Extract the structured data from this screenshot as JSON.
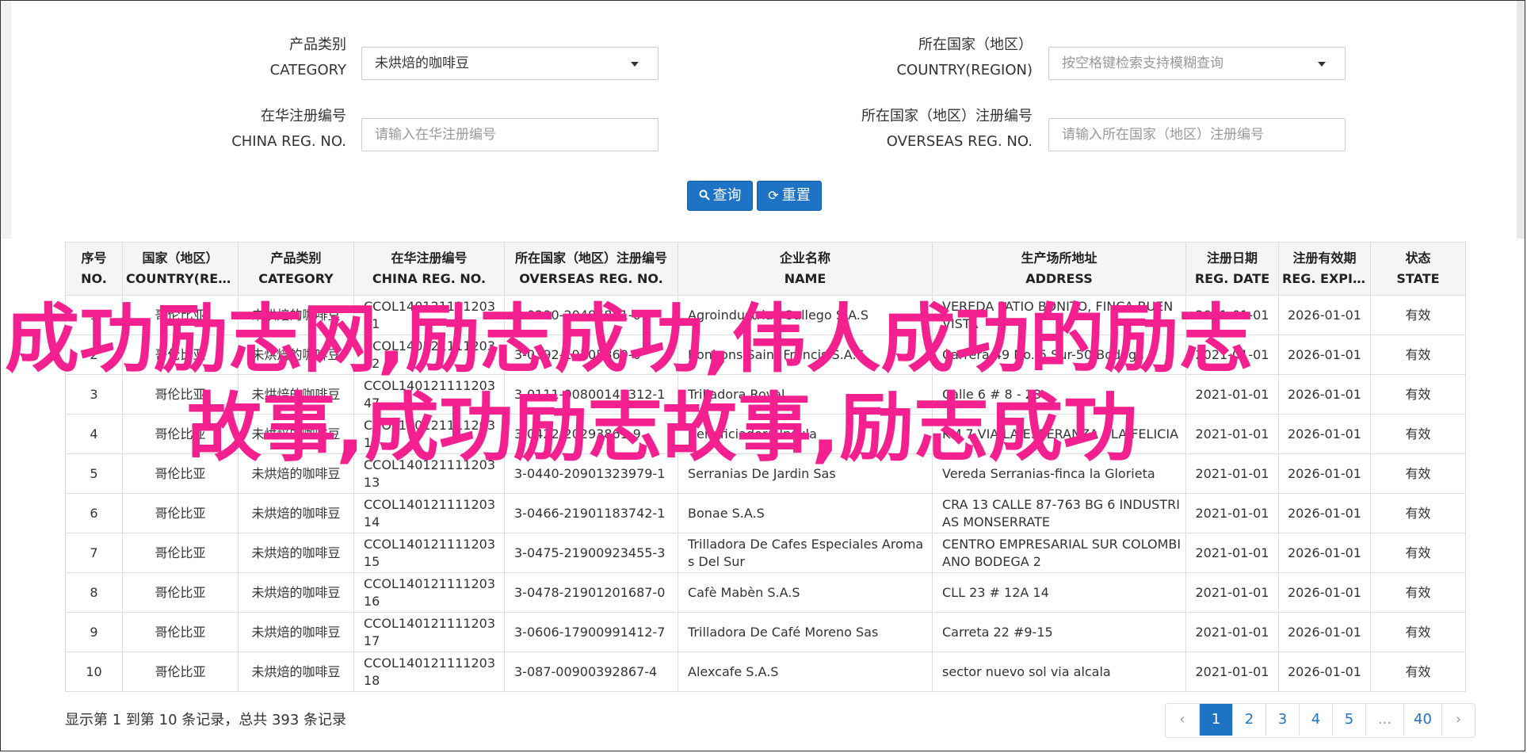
{
  "form": {
    "category_label_cn": "产品类别",
    "category_label_en": "CATEGORY",
    "category_value": "未烘焙的咖啡豆",
    "country_label_cn": "所在国家（地区）",
    "country_label_en": "COUNTRY(REGION)",
    "country_placeholder": "按空格键检索支持模糊查询",
    "china_reg_label_cn": "在华注册编号",
    "china_reg_label_en": "CHINA REG. NO.",
    "china_reg_placeholder": "请输入在华注册编号",
    "overseas_reg_label_cn": "所在国家（地区）注册编号",
    "overseas_reg_label_en": "OVERSEAS REG. NO.",
    "overseas_reg_placeholder": "请输入所在国家（地区）注册编号",
    "query_label": "查询",
    "reset_label": "重置"
  },
  "table": {
    "columns": [
      {
        "cn": "序号",
        "en": "NO."
      },
      {
        "cn": "国家（地区）",
        "en": "COUNTRY(REGIO..."
      },
      {
        "cn": "产品类别",
        "en": "CATEGORY"
      },
      {
        "cn": "在华注册编号",
        "en": "CHINA REG. NO."
      },
      {
        "cn": "所在国家（地区）注册编号",
        "en": "OVERSEAS REG. NO."
      },
      {
        "cn": "企业名称",
        "en": "NAME"
      },
      {
        "cn": "生产场所地址",
        "en": "ADDRESS"
      },
      {
        "cn": "注册日期",
        "en": "REG. DATE"
      },
      {
        "cn": "注册有效期",
        "en": "REG. EXPIRE ..."
      },
      {
        "cn": "状态",
        "en": "STATE"
      }
    ],
    "rows": [
      [
        "1",
        "哥伦比亚",
        "未烘焙的咖啡豆",
        "CCOL14012111120311",
        "3-0290-20486851-0",
        "Agroindustrias Gallego S.A.S",
        "VEREDA PATIO BONITO, FINCA BUEN VISTA",
        "2021-01-01",
        "2026-01-01",
        "有效"
      ],
      [
        "2",
        "哥伦比亚",
        "未烘焙的咖啡豆",
        "CCOL14012111120312",
        "3-0392-19305869-0",
        "Bonbons Saint Francis S.A.S",
        "Carrera 49 No. 5 Sur-50 Bodega 5",
        "2021-01-01",
        "2026-01-01",
        "有效"
      ],
      [
        "3",
        "哥伦比亚",
        "未烘焙的咖啡豆",
        "CCOL14012111120347",
        "3-0111-00800148312-1",
        "Trilladora Royal",
        "Calle 6 # 8 - 23",
        "2021-01-01",
        "2026-01-01",
        "有效"
      ],
      [
        "4",
        "哥伦比亚",
        "未烘焙的咖啡豆",
        "CCOL14012111120312",
        "3-0422-20293861-9",
        "Beneficiadora Insula",
        "KM 7 VIA LA ESPERANZA - LA FELICIA",
        "2021-01-01",
        "2026-01-01",
        "有效"
      ],
      [
        "5",
        "哥伦比亚",
        "未烘焙的咖啡豆",
        "CCOL14012111120313",
        "3-0440-20901323979-1",
        "Serranias De Jardin Sas",
        "Vereda Serranias-finca la Glorieta",
        "2021-01-01",
        "2026-01-01",
        "有效"
      ],
      [
        "6",
        "哥伦比亚",
        "未烘焙的咖啡豆",
        "CCOL14012111120314",
        "3-0466-21901183742-1",
        "Bonae S.A.S",
        "CRA 13 CALLE 87-763 BG 6 INDUSTRIAS MONSERRATE",
        "2021-01-01",
        "2026-01-01",
        "有效"
      ],
      [
        "7",
        "哥伦比亚",
        "未烘焙的咖啡豆",
        "CCOL14012111120315",
        "3-0475-21900923455-3",
        "Trilladora De Cafes Especiales Aromas Del Sur",
        "CENTRO EMPRESARIAL SUR COLOMBIANO BODEGA 2",
        "2021-01-01",
        "2026-01-01",
        "有效"
      ],
      [
        "8",
        "哥伦比亚",
        "未烘焙的咖啡豆",
        "CCOL14012111120316",
        "3-0478-21901201687-0",
        "Cafè Mabèn S.A.S",
        "CLL 23 # 12A 14",
        "2021-01-01",
        "2026-01-01",
        "有效"
      ],
      [
        "9",
        "哥伦比亚",
        "未烘焙的咖啡豆",
        "CCOL14012111120317",
        "3-0606-17900991412-7",
        "Trilladora De Café Moreno Sas",
        "Carreta 22 #9-15",
        "2021-01-01",
        "2026-01-01",
        "有效"
      ],
      [
        "10",
        "哥伦比亚",
        "未烘焙的咖啡豆",
        "CCOL14012111120318",
        "3-087-00900392867-4",
        "Alexcafe S.A.S",
        "sector nuevo sol via alcala",
        "2021-01-01",
        "2026-01-01",
        "有效"
      ]
    ]
  },
  "summary": "显示第 1 到第 10 条记录，总共 393 条记录",
  "pagination": [
    "‹",
    "1",
    "2",
    "3",
    "4",
    "5",
    "...",
    "40",
    "›"
  ],
  "pagination_active": "1",
  "watermark": {
    "line1": "成功励志网,励志成功,伟人成功的励志",
    "line2": "故事,成功励志故事,励志成功",
    "color": "#f5208f"
  },
  "colors": {
    "primary": "#1f73c5",
    "header_bg": "#f5f5f5",
    "border": "#dedede"
  }
}
